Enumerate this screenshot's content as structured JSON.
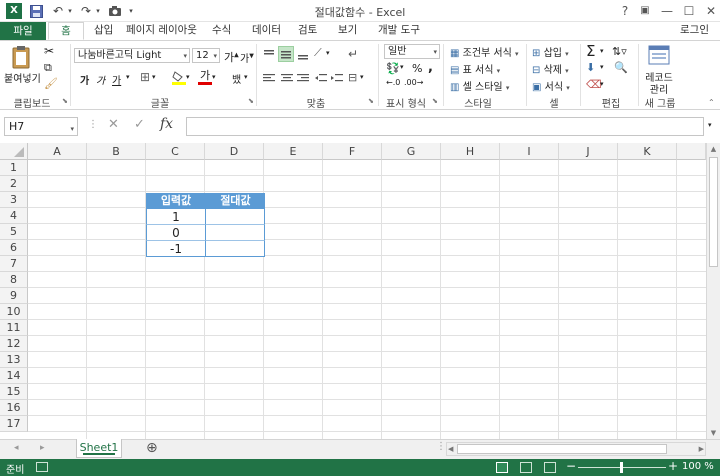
{
  "window": {
    "title": "절대값함수 - Excel",
    "help": "?",
    "ribbon_opts": "▣",
    "minimize": "—",
    "maximize": "☐",
    "close": "✕",
    "app_logo": "X",
    "account": "로그인"
  },
  "quick_access": {
    "save": "💾",
    "undo": "↶",
    "redo": "↷",
    "camera": "📷"
  },
  "tabs": {
    "file": "파일",
    "items": [
      "홈",
      "삽입",
      "페이지 레이아웃",
      "수식",
      "데이터",
      "검토",
      "보기",
      "개발 도구"
    ],
    "active_index": 0
  },
  "ribbon": {
    "clipboard": {
      "paste": "붙여넣기",
      "group": "클립보드"
    },
    "font": {
      "name": "나눔바른고딕 Light",
      "size": "12",
      "bold": "가",
      "italic": "가",
      "underline": "가",
      "group": "글꼴"
    },
    "align": {
      "group": "맞춤"
    },
    "number": {
      "format": "일반",
      "percent": "%",
      "comma": ",",
      "group": "표시 형식"
    },
    "styles": {
      "conditional": "조건부 서식",
      "table": "표 서식",
      "cell": "셀 스타일",
      "group": "스타일"
    },
    "cells": {
      "insert": "삽입",
      "delete": "삭제",
      "format": "서식",
      "group": "셀"
    },
    "edit": {
      "sum": "Σ",
      "group": "편집"
    },
    "record": {
      "label1": "레코드",
      "label2": "관리",
      "group": "새 그룹"
    }
  },
  "formula_bar": {
    "name_box": "H7",
    "cancel": "✕",
    "enter": "✓",
    "fx": "fx",
    "value": ""
  },
  "columns": [
    "A",
    "B",
    "C",
    "D",
    "E",
    "F",
    "G",
    "H",
    "I",
    "J",
    "K"
  ],
  "rows": [
    "1",
    "2",
    "3",
    "4",
    "5",
    "6",
    "7",
    "8",
    "9",
    "10",
    "11",
    "12",
    "13",
    "14",
    "15",
    "16",
    "17"
  ],
  "table": {
    "headers": [
      "입력값",
      "절대값"
    ],
    "rows": [
      [
        "1",
        ""
      ],
      [
        "0",
        ""
      ],
      [
        "-1",
        ""
      ]
    ]
  },
  "sheets": {
    "active": "Sheet1",
    "add": "⊕",
    "prev": "◂",
    "next": "▸"
  },
  "status": {
    "ready": "준비",
    "zoom": "100 %",
    "zoom_out": "−",
    "zoom_in": "+"
  },
  "colors": {
    "excel_green": "#217346",
    "table_header": "#5b9bd5"
  }
}
